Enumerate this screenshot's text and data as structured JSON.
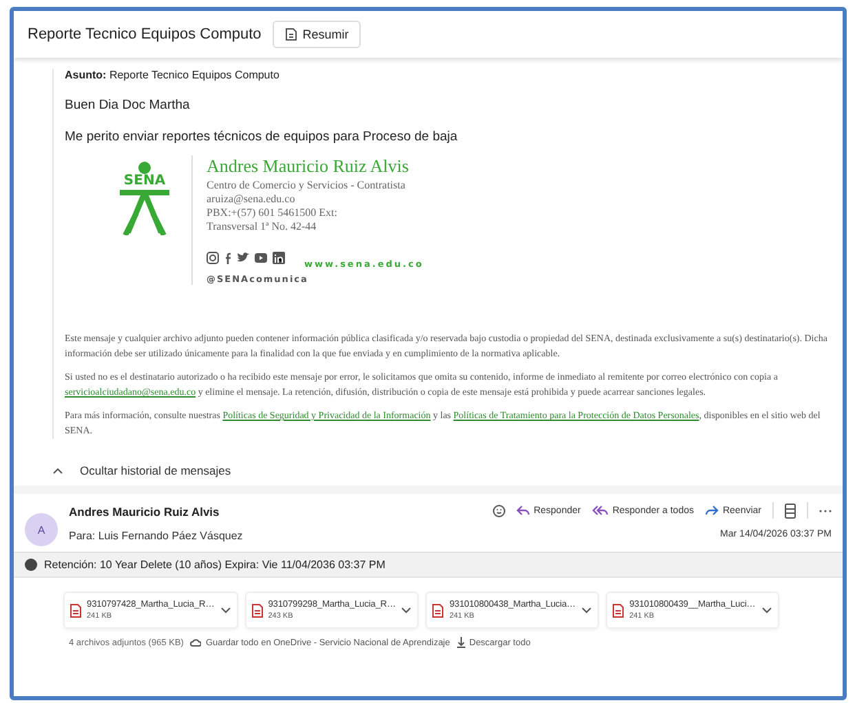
{
  "conversation_title": "Reporte Tecnico Equipos Computo",
  "summarize_button": "Resumir",
  "body": {
    "subject_label": "Asunto:",
    "subject": "Reporte Tecnico Equipos Computo",
    "greeting": "Buen Dia Doc Martha",
    "message": "Me perito enviar reportes técnicos de equipos para Proceso de baja"
  },
  "signature": {
    "logo_text": "SENA",
    "name": "Andres Mauricio Ruiz Alvis",
    "lines": [
      "Centro de Comercio y Servicios - Contratista",
      "aruiza@sena.edu.co",
      "PBX:+(57) 601 5461500 Ext:",
      "Transversal 1ª No. 42-44"
    ],
    "website": "www.sena.edu.co",
    "handle": "@SENAcomunica"
  },
  "disclaimer": [
    [
      {
        "kind": "text",
        "text": "Este mensaje y cualquier archivo adjunto pueden contener información pública clasificada y/o reservada bajo custodia o propiedad del SENA, destinada exclusivamente a su(s) destinatario(s). Dicha información debe ser utilizado únicamente para la finalidad con la que fue enviada y en cumplimiento de la normativa aplicable."
      }
    ],
    [
      {
        "kind": "text",
        "text": "Si usted no es el destinatario autorizado o ha recibido este mensaje por error, le solicitamos que omita su contenido, informe de inmediato al remitente por correo electrónico con copia a "
      },
      {
        "kind": "link",
        "text": "servicioalciudadano@sena.edu.co"
      },
      {
        "kind": "text",
        "text": " y elimine el mensaje. La retención, difusión, distribución o copia de este mensaje está prohibida y puede acarrear sanciones legales."
      }
    ],
    [
      {
        "kind": "text",
        "text": "Para más información, consulte nuestras "
      },
      {
        "kind": "link",
        "text": "Políticas de Seguridad y Privacidad de la Información"
      },
      {
        "kind": "text",
        "text": " y las "
      },
      {
        "kind": "link",
        "text": "Políticas de Tratamiento para la Protección de Datos Personales"
      },
      {
        "kind": "text",
        "text": ", disponibles en el sitio web del SENA."
      }
    ]
  ],
  "history_toggle": {
    "label": "Ocultar historial de mensajes",
    "expanded": true
  },
  "message": {
    "avatar": "A",
    "sender": "Andres Mauricio Ruiz Alvis",
    "to_label": "Para:",
    "to": "Luis Fernando Páez Vásquez",
    "date": "Mar 14/04/2026 03:37 PM",
    "actions": [
      {
        "kind": "reply",
        "label": "Responder"
      },
      {
        "kind": "reply_all",
        "label": "Responder a todos"
      },
      {
        "kind": "forward",
        "label": "Reenviar"
      }
    ]
  },
  "retention": "Retención: 10 Year Delete (10 años) Expira: Vie 11/04/2036 03:37 PM",
  "attachments": [
    {
      "name": "9310797428_Martha_Lucia_R…",
      "size": "241 KB"
    },
    {
      "name": "9310799298_Martha_Lucia_R…",
      "size": "243 KB"
    },
    {
      "name": "931010800438_Martha_Lucia…",
      "size": "241 KB"
    },
    {
      "name": "931010800439__Martha_Luci…",
      "size": "241 KB"
    }
  ],
  "attachments_footer": {
    "summary": "4 archivos adjuntos (965 KB)",
    "save": "Guardar todo en OneDrive - Servicio Nacional de Aprendizaje",
    "download": "Descargar todo"
  }
}
